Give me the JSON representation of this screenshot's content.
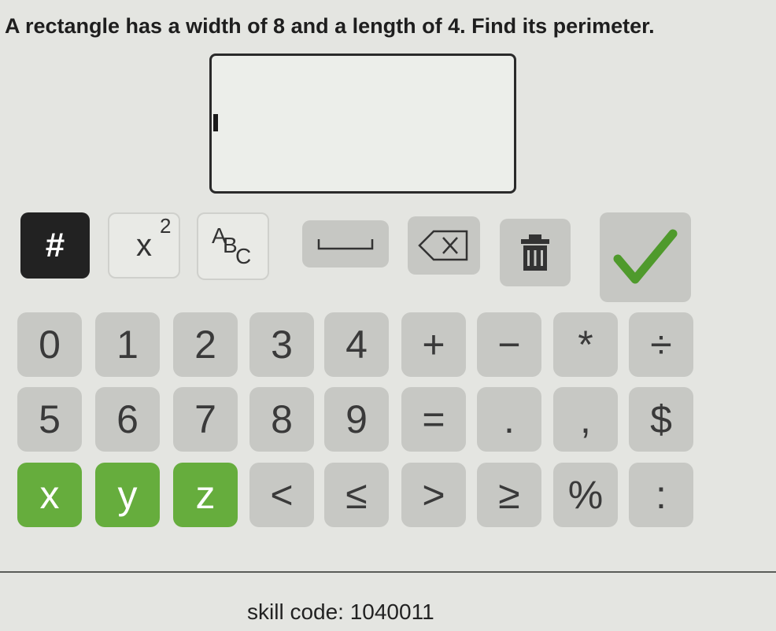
{
  "question": "A rectangle has a width of 8 and a length of 4.  Find its perimeter.",
  "answer": {
    "value": ""
  },
  "toolbar": {
    "hash_label": "#",
    "exponent_base": "x",
    "exponent_power": "2",
    "sub_a": "A",
    "sub_b": "B",
    "sub_c": "C"
  },
  "keypad": {
    "rows": [
      [
        "0",
        "1",
        "2",
        "3",
        "4",
        "+",
        "−",
        "*",
        "÷"
      ],
      [
        "5",
        "6",
        "7",
        "8",
        "9",
        "=",
        ".",
        ",",
        "$"
      ],
      [
        "x",
        "y",
        "z",
        "<",
        "≤",
        ">",
        "≥",
        "%",
        ":"
      ]
    ]
  },
  "colors": {
    "key_grey": "#c7c8c4",
    "key_green": "#66ad3d",
    "check_green": "#4f9a2c",
    "hash_bg": "#222222"
  },
  "footer": {
    "skill_code": "skill code: 1040011"
  }
}
